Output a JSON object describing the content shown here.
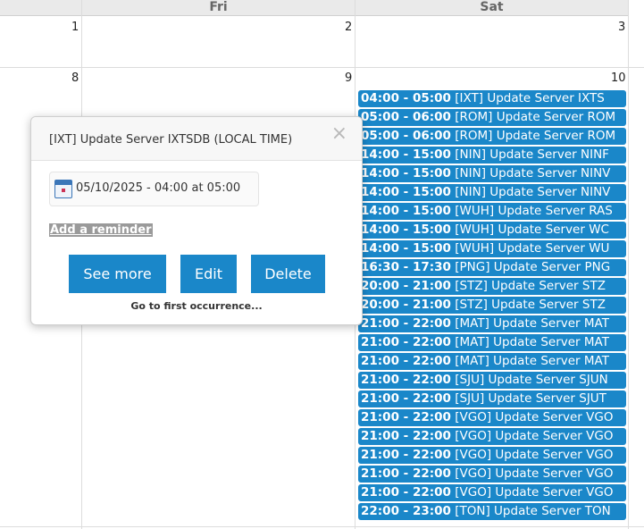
{
  "calendar": {
    "headers": [
      "Fri",
      "Sat"
    ],
    "days": [
      "1",
      "2",
      "3",
      "8",
      "9",
      "10"
    ]
  },
  "events": [
    {
      "time": "04:00 - 05:00",
      "title": "[IXT] Update Server IXTS"
    },
    {
      "time": "05:00 - 06:00",
      "title": "[ROM] Update Server ROM"
    },
    {
      "time": "05:00 - 06:00",
      "title": "[ROM] Update Server ROM"
    },
    {
      "time": "14:00 - 15:00",
      "title": "[NIN] Update Server NINF"
    },
    {
      "time": "14:00 - 15:00",
      "title": "[NIN] Update Server NINV"
    },
    {
      "time": "14:00 - 15:00",
      "title": "[NIN] Update Server NINV"
    },
    {
      "time": "14:00 - 15:00",
      "title": "[WUH] Update Server RAS"
    },
    {
      "time": "14:00 - 15:00",
      "title": "[WUH] Update Server WC"
    },
    {
      "time": "14:00 - 15:00",
      "title": "[WUH] Update Server WU"
    },
    {
      "time": "16:30 - 17:30",
      "title": "[PNG] Update Server PNG"
    },
    {
      "time": "20:00 - 21:00",
      "title": "[STZ] Update Server STZ"
    },
    {
      "time": "20:00 - 21:00",
      "title": "[STZ] Update Server STZ"
    },
    {
      "time": "21:00 - 22:00",
      "title": "[MAT] Update Server MAT"
    },
    {
      "time": "21:00 - 22:00",
      "title": "[MAT] Update Server MAT"
    },
    {
      "time": "21:00 - 22:00",
      "title": "[MAT] Update Server MAT"
    },
    {
      "time": "21:00 - 22:00",
      "title": "[SJU] Update Server SJUN"
    },
    {
      "time": "21:00 - 22:00",
      "title": "[SJU] Update Server SJUT"
    },
    {
      "time": "21:00 - 22:00",
      "title": "[VGO] Update Server VGO"
    },
    {
      "time": "21:00 - 22:00",
      "title": "[VGO] Update Server VGO"
    },
    {
      "time": "21:00 - 22:00",
      "title": "[VGO] Update Server VGO"
    },
    {
      "time": "21:00 - 22:00",
      "title": "[VGO] Update Server VGO"
    },
    {
      "time": "21:00 - 22:00",
      "title": "[VGO] Update Server VGO"
    },
    {
      "time": "22:00 - 23:00",
      "title": "[TON] Update Server TON"
    }
  ],
  "popup": {
    "title": "[IXT] Update Server IXTSDB (LOCAL TIME)",
    "close_symbol": "×",
    "date": "05/10/2025 - 04:00 at 05:00",
    "reminder": "Add a reminder",
    "see_more": "See more",
    "edit": "Edit",
    "delete": "Delete",
    "first_occurrence": "Go to first occurrence..."
  },
  "colors": {
    "event": "#1a87c9",
    "button": "#1a87c9"
  }
}
